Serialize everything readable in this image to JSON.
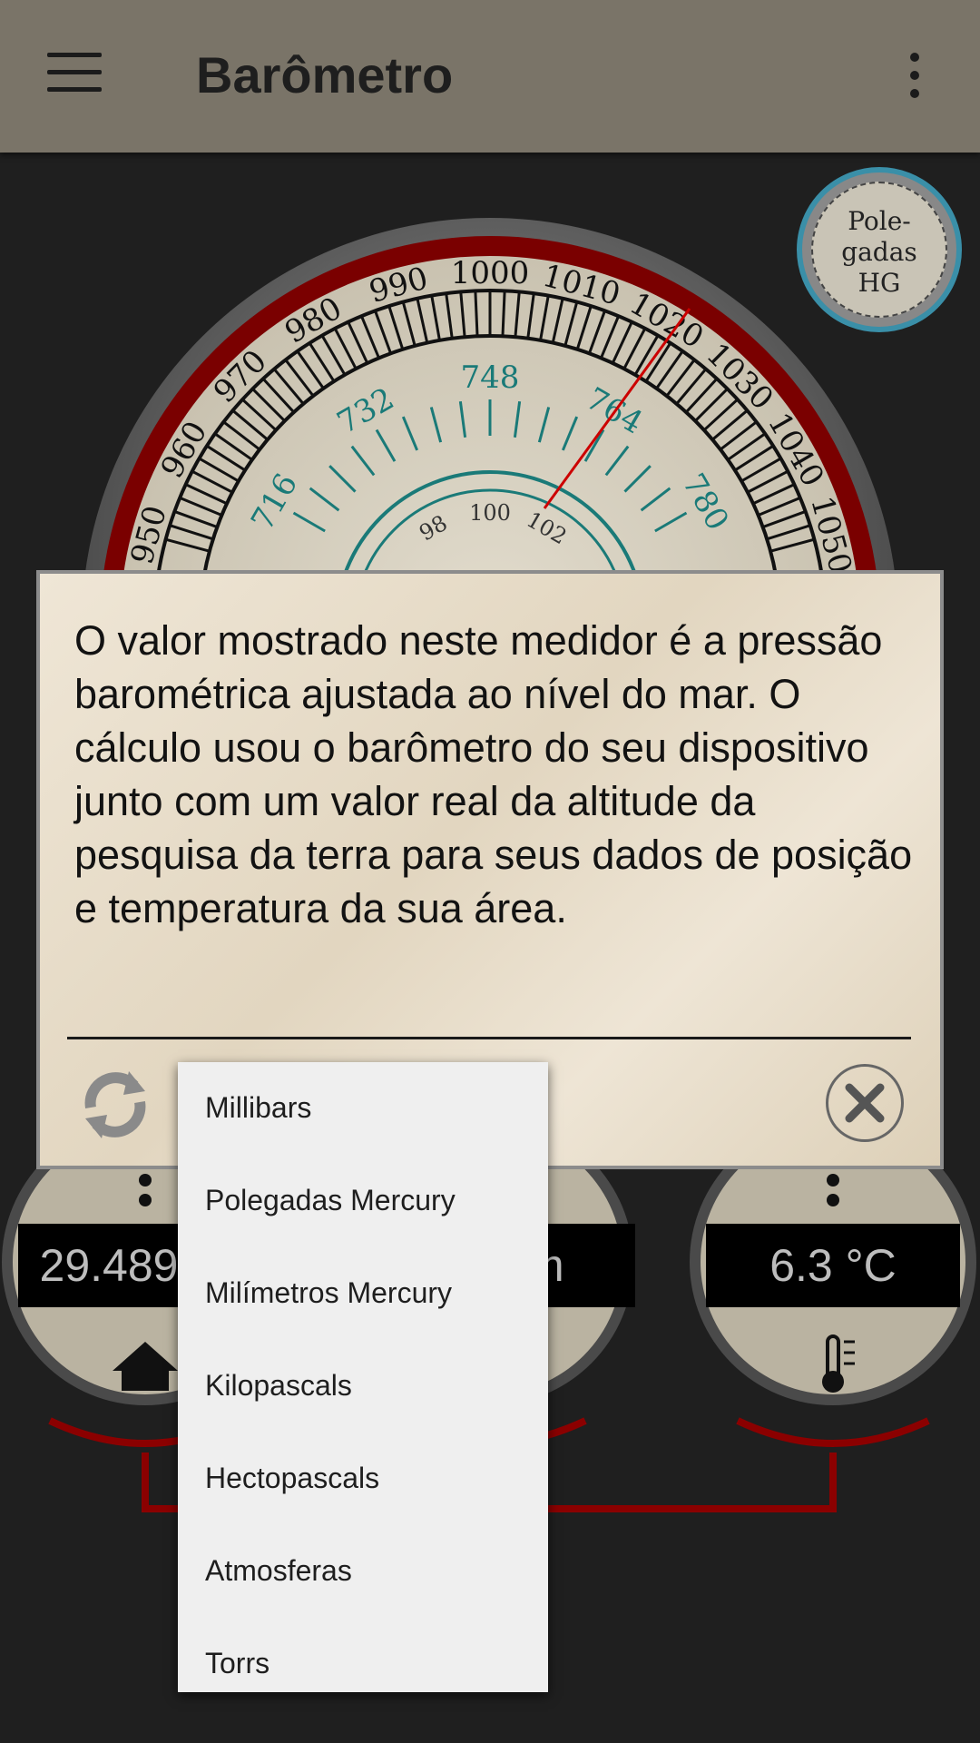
{
  "toolbar": {
    "title": "Barômetro",
    "menu_icon": "hamburger-menu-icon",
    "overflow_icon": "more-vert-icon"
  },
  "unit_badge": {
    "line1": "Pole-",
    "line2": "gadas",
    "line3": "HG"
  },
  "gauge": {
    "mb_labels": [
      "950",
      "960",
      "970",
      "980",
      "990",
      "1000",
      "1010",
      "1020",
      "1030",
      "1040",
      "1050"
    ],
    "mm_labels": [
      "716",
      "732",
      "748",
      "764",
      "780"
    ],
    "kpa_labels": [
      "98",
      "100",
      "102"
    ]
  },
  "dialog": {
    "text": "O valor mostrado neste medidor é a pressão barométrica ajustada ao nível do mar. O cálculo usou o barômetro do seu dispositivo junto com um valor real da altitude da pesquisa da terra para seus dados de posição e temperatura da sua área."
  },
  "dropdown": {
    "items": [
      "Millibars",
      "Polegadas Mercury",
      "Milímetros Mercury",
      "Kilopascals",
      "Hectopascals",
      "Atmosferas",
      "Torrs"
    ]
  },
  "readouts": {
    "left": "29.489",
    "middle": "m",
    "right": "6.3 °C"
  },
  "colors": {
    "toolbar": "#7a7468",
    "dialog": "#e8dcc8",
    "accent_red": "#8b0000",
    "dial_teal": "#1a7a78"
  }
}
